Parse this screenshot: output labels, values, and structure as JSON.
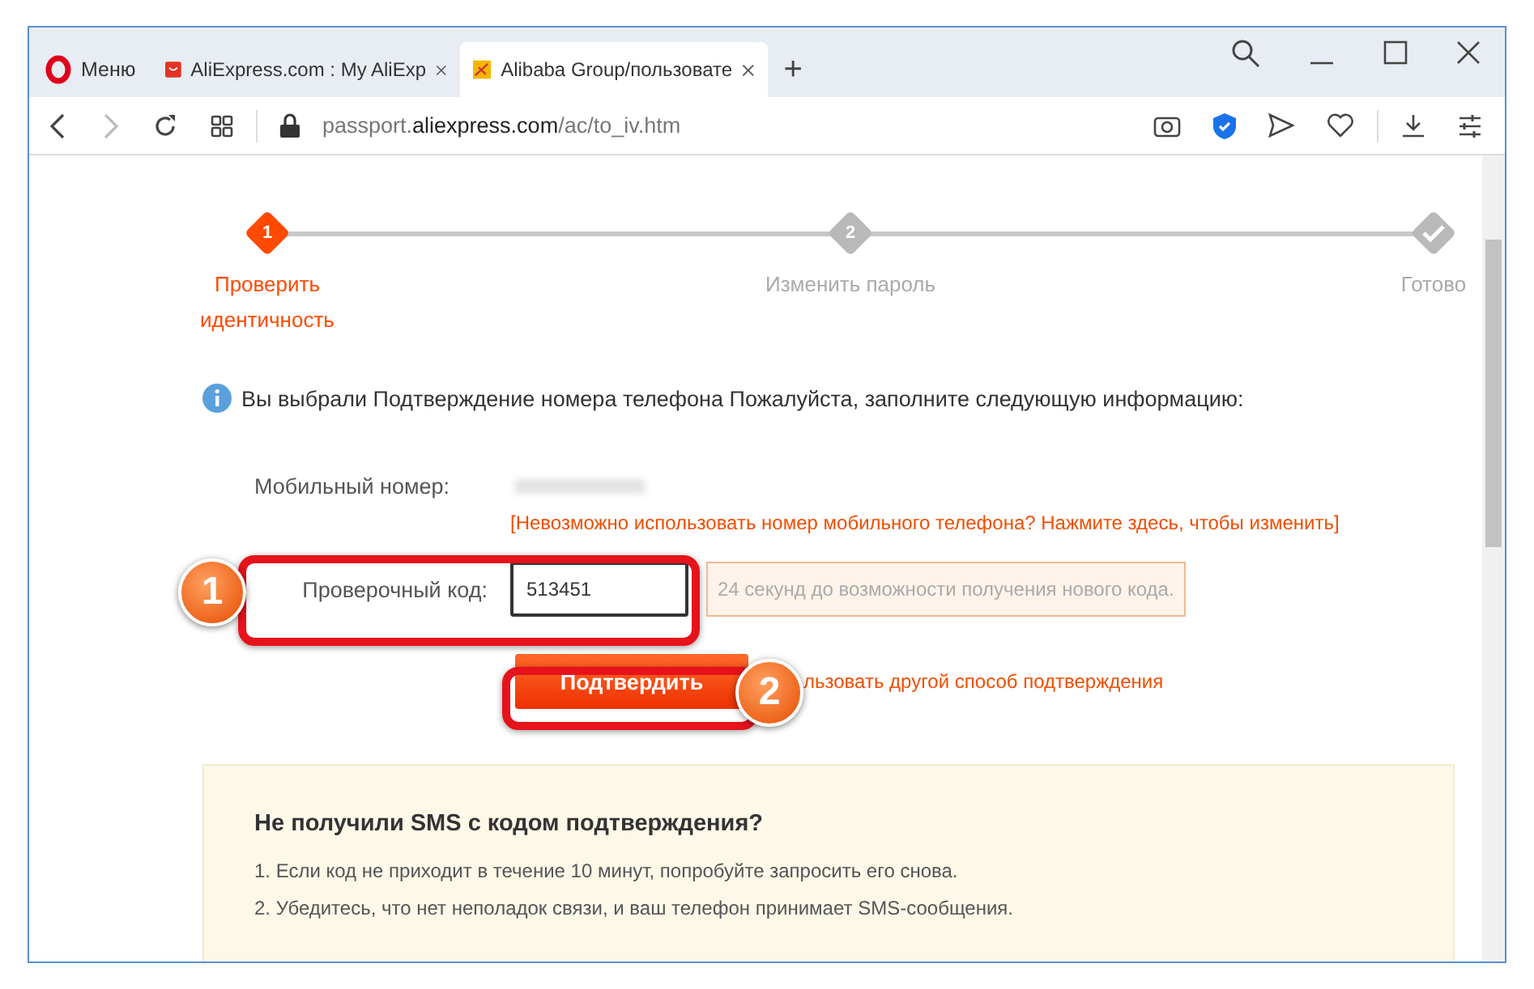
{
  "browser": {
    "menu_label": "Меню",
    "tabs": [
      {
        "title": "AliExpress.com : My AliExp",
        "selected": false
      },
      {
        "title": "Alibaba Group/пользовате",
        "selected": true
      }
    ],
    "new_tab": "+",
    "address": {
      "host_prefix": "passport.",
      "host_main": "aliexpress.com",
      "path": "/ac/to_iv.htm"
    }
  },
  "steps": [
    {
      "number": "1",
      "label": "Проверить идентичность",
      "active": true
    },
    {
      "number": "2",
      "label": "Изменить пароль",
      "active": false
    },
    {
      "label": "Готово",
      "active": false
    }
  ],
  "info": "Вы выбрали Подтверждение номера телефона Пожалуйста, заполните следующую информацию:",
  "form": {
    "mobile_label": "Мобильный номер:",
    "change_link": "[Невозможно использовать номер мобильного телефона? Нажмите здесь, чтобы изменить]",
    "code_label": "Проверочный код:",
    "code_value": "513451",
    "resend_hint": "24 секунд до возможности получения нового кода.",
    "submit": "Подтвердить",
    "other_method_link": "льзовать другой способ подтверждения"
  },
  "annotations": [
    "1",
    "2"
  ],
  "help": {
    "title": "Не получили SMS с кодом подтверждения?",
    "items": [
      "1. Если код не приходит в течение 10 минут, попробуйте запросить его снова.",
      "2. Убедитесь, что нет неполадок связи, и ваш телефон принимает SMS-сообщения."
    ]
  }
}
